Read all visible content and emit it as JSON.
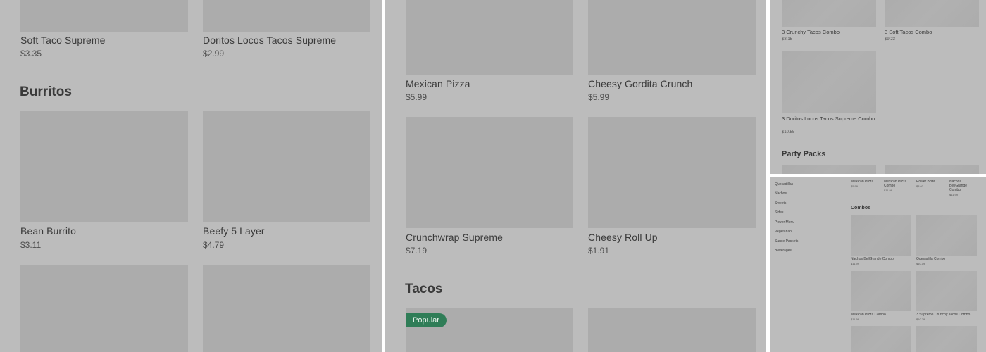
{
  "panel1": {
    "items_top": [
      {
        "name": "Soft Taco Supreme",
        "price": "$3.35"
      },
      {
        "name": "Doritos Locos Tacos Supreme",
        "price": "$2.99"
      }
    ],
    "section_title": "Burritos",
    "items": [
      {
        "name": "Bean Burrito",
        "price": "$3.11"
      },
      {
        "name": "Beefy 5 Layer",
        "price": "$4.79"
      }
    ]
  },
  "panel2": {
    "items_top": [
      {
        "name": "Mexican Pizza",
        "price": "$5.99"
      },
      {
        "name": "Cheesy Gordita Crunch",
        "price": "$5.99"
      },
      {
        "name": "Crunchwrap Supreme",
        "price": "$7.19"
      },
      {
        "name": "Cheesy Roll Up",
        "price": "$1.91"
      }
    ],
    "section_title": "Tacos",
    "badge": "Popular"
  },
  "panel3": {
    "items": [
      {
        "name": "3 Crunchy Tacos Combo",
        "price": "$8.15"
      },
      {
        "name": "3 Soft Tacos Combo",
        "price": "$9.23"
      },
      {
        "name": "3 Doritos Locos Tacos Supreme Combo",
        "price": "$10.55"
      }
    ],
    "section_title": "Party Packs"
  },
  "panel4": {
    "nav": [
      "Quesadillas",
      "Nachos",
      "Sweets",
      "Sides",
      "Power Menu",
      "Vegetarian",
      "Sauce Packets",
      "Beverages"
    ],
    "items_top": [
      {
        "name": "Mexican Pizza",
        "price": "$5.99"
      },
      {
        "name": "Mexican Pizza Combo",
        "price": "$11.99"
      },
      {
        "name": "Power Bowl",
        "price": "$8.03"
      },
      {
        "name": "Nachos BellGrande Combo",
        "price": "$11.99"
      }
    ],
    "section_title": "Combos",
    "items": [
      {
        "name": "Nachos BellGrande Combo",
        "price": "$11.99"
      },
      {
        "name": "Quesadilla Combo",
        "price": "$10.19"
      },
      {
        "name": "Mexican Pizza Combo",
        "price": "$11.99"
      },
      {
        "name": "3 Supreme Crunchy Tacos Combo",
        "price": "$10.79"
      }
    ]
  }
}
